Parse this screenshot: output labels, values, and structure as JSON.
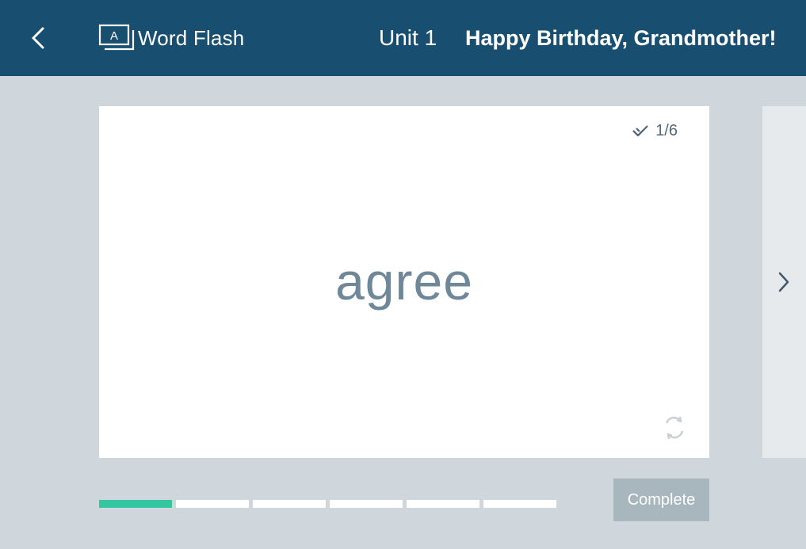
{
  "header": {
    "back_icon": "chevron-left-icon",
    "brand_icon": "flashcard-icon",
    "brand_icon_letter": "A",
    "app_title": "Word Flash",
    "unit": "Unit 1",
    "lesson_title": "Happy Birthday, Grandmother!",
    "background": "#184f70"
  },
  "card": {
    "progress_icon": "double-check-icon",
    "progress": "1/6",
    "word": "agree",
    "flip_icon": "flip-arrows-icon"
  },
  "navigation": {
    "next_icon": "chevron-right-icon"
  },
  "progress_bar": {
    "total": 6,
    "current": 1,
    "active_color": "#34c6a1"
  },
  "actions": {
    "complete_label": "Complete"
  }
}
